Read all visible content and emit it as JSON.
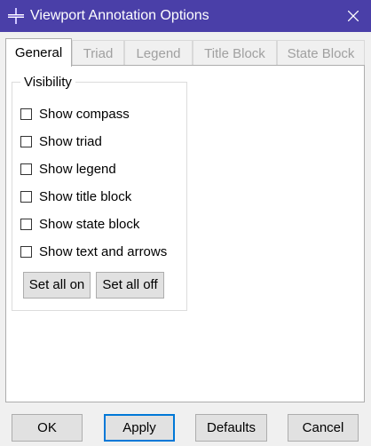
{
  "window": {
    "title": "Viewport Annotation Options"
  },
  "tabs": [
    {
      "label": "General",
      "active": true
    },
    {
      "label": "Triad",
      "active": false
    },
    {
      "label": "Legend",
      "active": false
    },
    {
      "label": "Title Block",
      "active": false
    },
    {
      "label": "State Block",
      "active": false
    }
  ],
  "visibility": {
    "legend": "Visibility",
    "options": [
      {
        "label": "Show compass",
        "checked": false
      },
      {
        "label": "Show triad",
        "checked": false
      },
      {
        "label": "Show legend",
        "checked": false
      },
      {
        "label": "Show title block",
        "checked": false
      },
      {
        "label": "Show state block",
        "checked": false
      },
      {
        "label": "Show text and arrows",
        "checked": false
      }
    ],
    "set_all_on": "Set all on",
    "set_all_off": "Set all off"
  },
  "buttons": {
    "ok": "OK",
    "apply": "Apply",
    "defaults": "Defaults",
    "cancel": "Cancel"
  },
  "colors": {
    "title_bar": "#4a3fa8",
    "focus_border": "#0078d7",
    "disabled_text": "#a0a0a0"
  },
  "icons": {
    "app": "viewport-app-icon",
    "close": "close-icon"
  }
}
